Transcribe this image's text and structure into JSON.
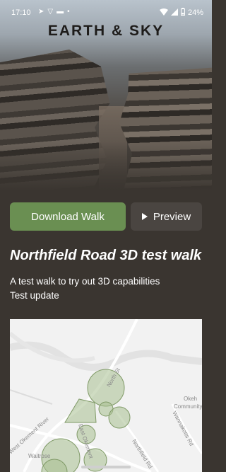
{
  "status_bar": {
    "time": "17:10",
    "battery": "24%"
  },
  "brand": {
    "name": "EARTH & SKY"
  },
  "actions": {
    "download_label": "Download Walk",
    "preview_label": "Preview"
  },
  "walk": {
    "title": "Northfield Road 3D test walk",
    "description_line1": "A test walk to try out 3D capabilities",
    "description_line2": "Test update"
  },
  "map": {
    "labels": {
      "north_st": "North St",
      "river": "West Okement River",
      "waitrose": "Waitrose",
      "east_okement": "East Okement",
      "northfield_rd": "Northfield Rd",
      "okehampton": "Okeh",
      "community": "Community",
      "wannakotts": "Wannakotts Rd"
    }
  },
  "colors": {
    "accent": "#6a8f52",
    "preview_bg": "#4a4541",
    "page_bg": "#3a3530",
    "map_poi": "#a8c08f"
  }
}
